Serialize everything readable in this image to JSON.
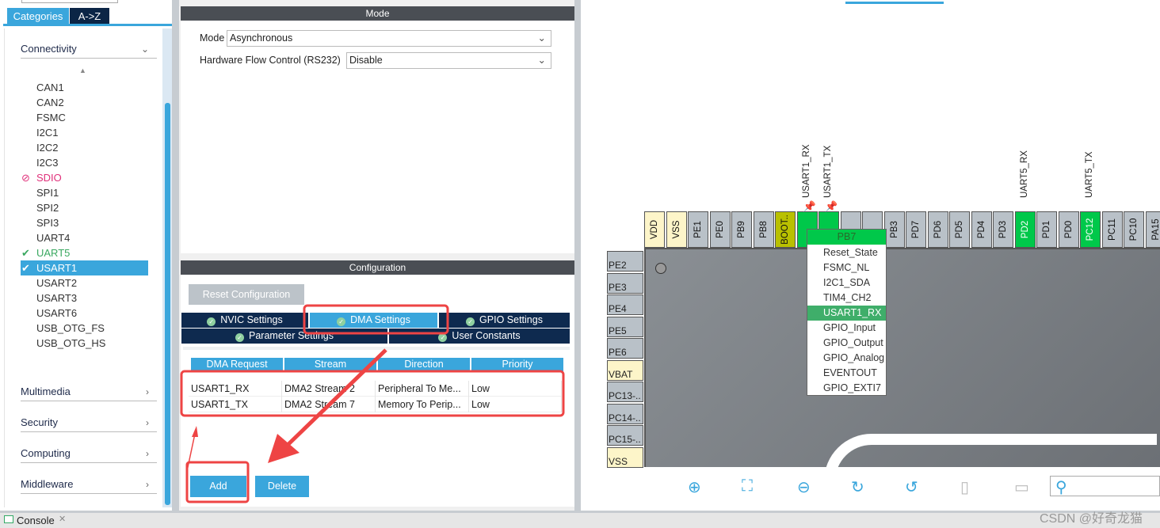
{
  "left_panel": {
    "tabs": [
      "Categories",
      "A->Z"
    ],
    "categories": {
      "connectivity": "Connectivity",
      "multimedia": "Multimedia",
      "security": "Security",
      "computing": "Computing",
      "middleware": "Middleware"
    },
    "peripherals": [
      {
        "label": "CAN1",
        "status": "none"
      },
      {
        "label": "CAN2",
        "status": "none"
      },
      {
        "label": "FSMC",
        "status": "none"
      },
      {
        "label": "I2C1",
        "status": "none"
      },
      {
        "label": "I2C2",
        "status": "none"
      },
      {
        "label": "I2C3",
        "status": "none"
      },
      {
        "label": "SDIO",
        "status": "disabled"
      },
      {
        "label": "SPI1",
        "status": "none"
      },
      {
        "label": "SPI2",
        "status": "none"
      },
      {
        "label": "SPI3",
        "status": "none"
      },
      {
        "label": "UART4",
        "status": "none"
      },
      {
        "label": "UART5",
        "status": "enabled"
      },
      {
        "label": "USART1",
        "status": "selected"
      },
      {
        "label": "USART2",
        "status": "none"
      },
      {
        "label": "USART3",
        "status": "none"
      },
      {
        "label": "USART6",
        "status": "none"
      },
      {
        "label": "USB_OTG_FS",
        "status": "none"
      },
      {
        "label": "USB_OTG_HS",
        "status": "none"
      }
    ]
  },
  "mode": {
    "header": "Mode",
    "mode_label": "Mode",
    "mode_value": "Asynchronous",
    "flow_label": "Hardware Flow Control (RS232)",
    "flow_value": "Disable"
  },
  "configuration": {
    "header": "Configuration",
    "reset_button": "Reset Configuration",
    "tabs": {
      "nvic": "NVIC Settings",
      "dma": "DMA Settings",
      "gpio": "GPIO Settings",
      "parameter": "Parameter Settings",
      "user": "User Constants"
    },
    "dma_table": {
      "columns": [
        "DMA Request",
        "Stream",
        "Direction",
        "Priority"
      ],
      "rows": [
        [
          "USART1_RX",
          "DMA2 Stream 2",
          "Peripheral To Me...",
          "Low"
        ],
        [
          "USART1_TX",
          "DMA2 Stream 7",
          "Memory To Perip...",
          "Low"
        ]
      ]
    },
    "add_button": "Add",
    "delete_button": "Delete"
  },
  "pinout": {
    "top_pins": [
      {
        "name": "VDD",
        "type": "power"
      },
      {
        "name": "VSS",
        "type": "power"
      },
      {
        "name": "PE1",
        "type": "io"
      },
      {
        "name": "PE0",
        "type": "io"
      },
      {
        "name": "PB9",
        "type": "io"
      },
      {
        "name": "PB8",
        "type": "io"
      },
      {
        "name": "BOOT..",
        "type": "boot"
      },
      {
        "name": "",
        "type": "active"
      },
      {
        "name": "",
        "type": "active"
      },
      {
        "name": "",
        "type": "io"
      },
      {
        "name": "",
        "type": "io"
      },
      {
        "name": "PB3",
        "type": "io"
      },
      {
        "name": "PD7",
        "type": "io"
      },
      {
        "name": "PD6",
        "type": "io"
      },
      {
        "name": "PD5",
        "type": "io"
      },
      {
        "name": "PD4",
        "type": "io"
      },
      {
        "name": "PD3",
        "type": "io"
      },
      {
        "name": "PD2",
        "type": "active"
      },
      {
        "name": "PD1",
        "type": "io"
      },
      {
        "name": "PD0",
        "type": "io"
      },
      {
        "name": "PC12",
        "type": "active"
      },
      {
        "name": "PC11",
        "type": "io"
      },
      {
        "name": "PC10",
        "type": "io"
      },
      {
        "name": "PA15",
        "type": "io"
      }
    ],
    "signals": [
      {
        "label": "USART1_RX",
        "pin_index": 7
      },
      {
        "label": "USART1_TX",
        "pin_index": 8
      },
      {
        "label": "UART5_RX",
        "pin_index": 17
      },
      {
        "label": "UART5_TX",
        "pin_index": 20
      }
    ],
    "left_pins": [
      {
        "name": "PE2",
        "type": "io"
      },
      {
        "name": "PE3",
        "type": "io"
      },
      {
        "name": "PE4",
        "type": "io"
      },
      {
        "name": "PE5",
        "type": "io"
      },
      {
        "name": "PE6",
        "type": "io"
      },
      {
        "name": "VBAT",
        "type": "power"
      },
      {
        "name": "PC13-..",
        "type": "io"
      },
      {
        "name": "PC14-..",
        "type": "io"
      },
      {
        "name": "PC15-..",
        "type": "io"
      },
      {
        "name": "VSS",
        "type": "power"
      }
    ],
    "popup": {
      "title": "PB7",
      "items": [
        "Reset_State",
        "FSMC_NL",
        "I2C1_SDA",
        "TIM4_CH2",
        "USART1_RX",
        "GPIO_Input",
        "GPIO_Output",
        "GPIO_Analog",
        "EVENTOUT",
        "GPIO_EXTI7"
      ],
      "selected": "USART1_RX"
    },
    "toolbar": [
      "zoom-in-icon",
      "fit-icon",
      "zoom-out-icon",
      "rotate-right-icon",
      "rotate-left-icon",
      "split-vertical-icon",
      "split-horizontal-icon",
      "search-icon"
    ],
    "colors": {
      "power": "#fdf5c9",
      "io": "#b9c1c8",
      "boot": "#b9c000",
      "active": "#00c84a",
      "accent": "#3aa6dc"
    }
  },
  "console": {
    "label": "Console"
  },
  "watermark": "CSDN @好奇龙猫"
}
